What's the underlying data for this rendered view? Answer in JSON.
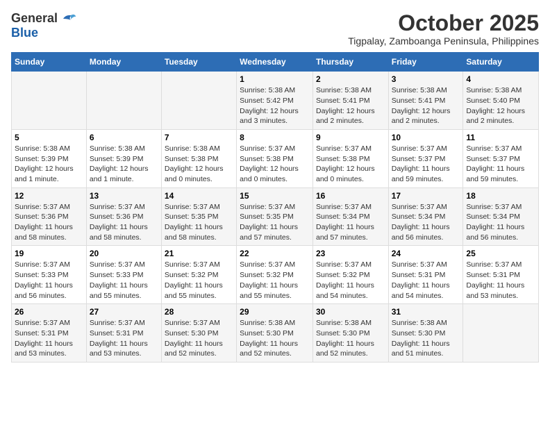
{
  "logo": {
    "general": "General",
    "blue": "Blue"
  },
  "title": "October 2025",
  "subtitle": "Tigpalay, Zamboanga Peninsula, Philippines",
  "days_of_week": [
    "Sunday",
    "Monday",
    "Tuesday",
    "Wednesday",
    "Thursday",
    "Friday",
    "Saturday"
  ],
  "weeks": [
    {
      "days": [
        {
          "num": "",
          "info": ""
        },
        {
          "num": "",
          "info": ""
        },
        {
          "num": "",
          "info": ""
        },
        {
          "num": "1",
          "info": "Sunrise: 5:38 AM\nSunset: 5:42 PM\nDaylight: 12 hours and 3 minutes."
        },
        {
          "num": "2",
          "info": "Sunrise: 5:38 AM\nSunset: 5:41 PM\nDaylight: 12 hours and 2 minutes."
        },
        {
          "num": "3",
          "info": "Sunrise: 5:38 AM\nSunset: 5:41 PM\nDaylight: 12 hours and 2 minutes."
        },
        {
          "num": "4",
          "info": "Sunrise: 5:38 AM\nSunset: 5:40 PM\nDaylight: 12 hours and 2 minutes."
        }
      ]
    },
    {
      "days": [
        {
          "num": "5",
          "info": "Sunrise: 5:38 AM\nSunset: 5:39 PM\nDaylight: 12 hours and 1 minute."
        },
        {
          "num": "6",
          "info": "Sunrise: 5:38 AM\nSunset: 5:39 PM\nDaylight: 12 hours and 1 minute."
        },
        {
          "num": "7",
          "info": "Sunrise: 5:38 AM\nSunset: 5:38 PM\nDaylight: 12 hours and 0 minutes."
        },
        {
          "num": "8",
          "info": "Sunrise: 5:37 AM\nSunset: 5:38 PM\nDaylight: 12 hours and 0 minutes."
        },
        {
          "num": "9",
          "info": "Sunrise: 5:37 AM\nSunset: 5:38 PM\nDaylight: 12 hours and 0 minutes."
        },
        {
          "num": "10",
          "info": "Sunrise: 5:37 AM\nSunset: 5:37 PM\nDaylight: 11 hours and 59 minutes."
        },
        {
          "num": "11",
          "info": "Sunrise: 5:37 AM\nSunset: 5:37 PM\nDaylight: 11 hours and 59 minutes."
        }
      ]
    },
    {
      "days": [
        {
          "num": "12",
          "info": "Sunrise: 5:37 AM\nSunset: 5:36 PM\nDaylight: 11 hours and 58 minutes."
        },
        {
          "num": "13",
          "info": "Sunrise: 5:37 AM\nSunset: 5:36 PM\nDaylight: 11 hours and 58 minutes."
        },
        {
          "num": "14",
          "info": "Sunrise: 5:37 AM\nSunset: 5:35 PM\nDaylight: 11 hours and 58 minutes."
        },
        {
          "num": "15",
          "info": "Sunrise: 5:37 AM\nSunset: 5:35 PM\nDaylight: 11 hours and 57 minutes."
        },
        {
          "num": "16",
          "info": "Sunrise: 5:37 AM\nSunset: 5:34 PM\nDaylight: 11 hours and 57 minutes."
        },
        {
          "num": "17",
          "info": "Sunrise: 5:37 AM\nSunset: 5:34 PM\nDaylight: 11 hours and 56 minutes."
        },
        {
          "num": "18",
          "info": "Sunrise: 5:37 AM\nSunset: 5:34 PM\nDaylight: 11 hours and 56 minutes."
        }
      ]
    },
    {
      "days": [
        {
          "num": "19",
          "info": "Sunrise: 5:37 AM\nSunset: 5:33 PM\nDaylight: 11 hours and 56 minutes."
        },
        {
          "num": "20",
          "info": "Sunrise: 5:37 AM\nSunset: 5:33 PM\nDaylight: 11 hours and 55 minutes."
        },
        {
          "num": "21",
          "info": "Sunrise: 5:37 AM\nSunset: 5:32 PM\nDaylight: 11 hours and 55 minutes."
        },
        {
          "num": "22",
          "info": "Sunrise: 5:37 AM\nSunset: 5:32 PM\nDaylight: 11 hours and 55 minutes."
        },
        {
          "num": "23",
          "info": "Sunrise: 5:37 AM\nSunset: 5:32 PM\nDaylight: 11 hours and 54 minutes."
        },
        {
          "num": "24",
          "info": "Sunrise: 5:37 AM\nSunset: 5:31 PM\nDaylight: 11 hours and 54 minutes."
        },
        {
          "num": "25",
          "info": "Sunrise: 5:37 AM\nSunset: 5:31 PM\nDaylight: 11 hours and 53 minutes."
        }
      ]
    },
    {
      "days": [
        {
          "num": "26",
          "info": "Sunrise: 5:37 AM\nSunset: 5:31 PM\nDaylight: 11 hours and 53 minutes."
        },
        {
          "num": "27",
          "info": "Sunrise: 5:37 AM\nSunset: 5:31 PM\nDaylight: 11 hours and 53 minutes."
        },
        {
          "num": "28",
          "info": "Sunrise: 5:37 AM\nSunset: 5:30 PM\nDaylight: 11 hours and 52 minutes."
        },
        {
          "num": "29",
          "info": "Sunrise: 5:38 AM\nSunset: 5:30 PM\nDaylight: 11 hours and 52 minutes."
        },
        {
          "num": "30",
          "info": "Sunrise: 5:38 AM\nSunset: 5:30 PM\nDaylight: 11 hours and 52 minutes."
        },
        {
          "num": "31",
          "info": "Sunrise: 5:38 AM\nSunset: 5:30 PM\nDaylight: 11 hours and 51 minutes."
        },
        {
          "num": "",
          "info": ""
        }
      ]
    }
  ]
}
